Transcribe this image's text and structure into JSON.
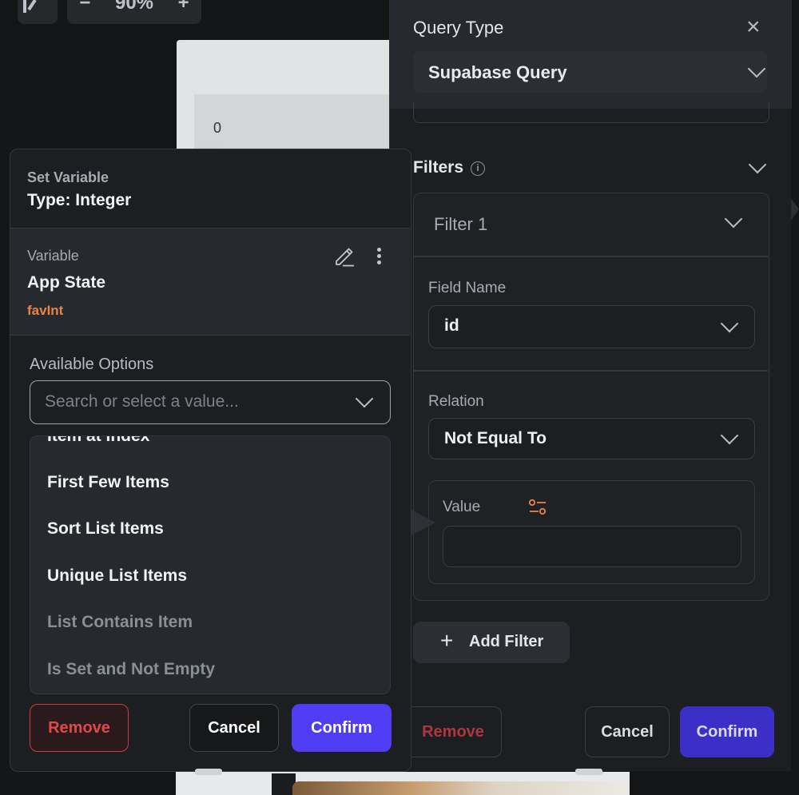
{
  "toolbar": {
    "zoom_minus": "−",
    "zoom_level": "90%",
    "zoom_plus": "+"
  },
  "canvas": {
    "preview_value": "0"
  },
  "query_panel": {
    "query_type_label": "Query Type",
    "close_symbol": "×",
    "query_type_value": "Supabase Query",
    "filters_label": "Filters",
    "info_symbol": "i",
    "filter": {
      "title": "Filter 1",
      "field_name_label": "Field Name",
      "field_name_value": "id",
      "relation_label": "Relation",
      "relation_value": "Not Equal To",
      "value_label": "Value",
      "value_input": ""
    },
    "add_filter_label": "Add Filter",
    "add_symbol": "+",
    "remove_label": "Remove",
    "cancel_label": "Cancel",
    "confirm_label": "Confirm"
  },
  "set_variable": {
    "header_label": "Set Variable",
    "type_label": "Type: Integer",
    "variable_label": "Variable",
    "variable_source": "App State",
    "variable_field": "favInt",
    "available_options_label": "Available Options",
    "search_placeholder": "Search or select a value...",
    "options": [
      {
        "label": "Item at Index",
        "enabled": true
      },
      {
        "label": "First Few Items",
        "enabled": true
      },
      {
        "label": "Sort List Items",
        "enabled": true
      },
      {
        "label": "Unique List Items",
        "enabled": true
      },
      {
        "label": "List Contains Item",
        "enabled": false
      },
      {
        "label": "Is Set and Not Empty",
        "enabled": false
      }
    ],
    "remove_label": "Remove",
    "cancel_label": "Cancel",
    "confirm_label": "Confirm"
  },
  "colors": {
    "accent_confirm": "#4f3cf3",
    "danger": "#e0484e",
    "variable_field": "#e8834a"
  }
}
